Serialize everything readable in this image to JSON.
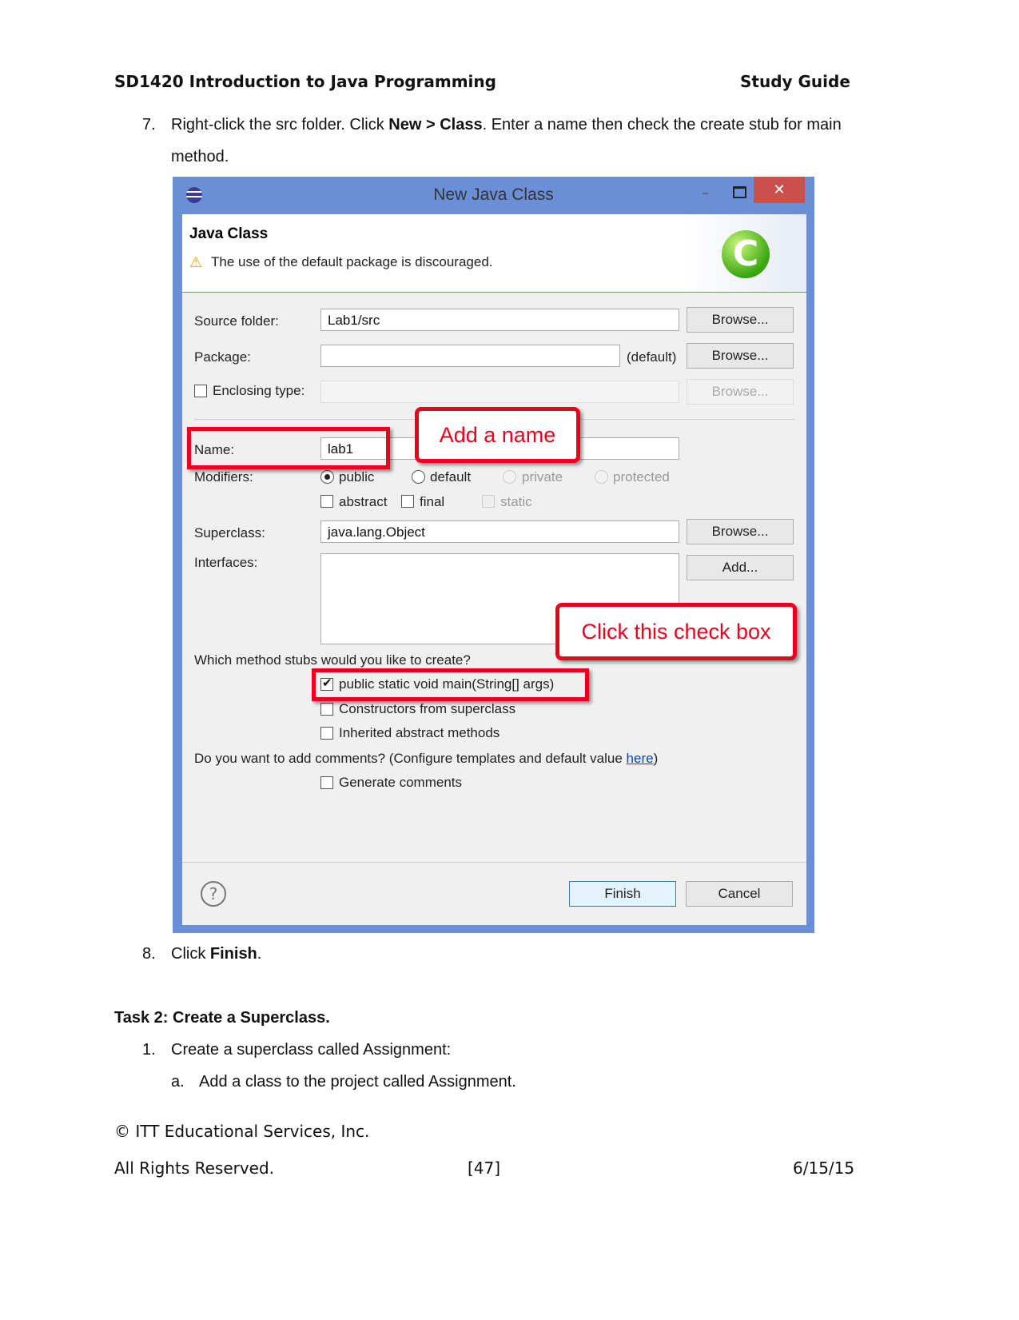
{
  "header": {
    "course": "SD1420 Introduction to Java Programming",
    "guide": "Study Guide"
  },
  "step7": {
    "num": "7.",
    "text_a": "Right-click the src folder. Click ",
    "bold_a": "New > Class",
    "text_b": ". Enter a name then check the create stub for main",
    "text_c": "method."
  },
  "dialog": {
    "title": "New Java Class",
    "section_title": "Java Class",
    "warning": "The use of the default package is discouraged.",
    "source_folder_label": "Source folder:",
    "source_folder_value": "Lab1/src",
    "package_label": "Package:",
    "package_value": "",
    "package_default": "(default)",
    "enclosing_label": "Enclosing type:",
    "browse": "Browse...",
    "name_label": "Name:",
    "name_value": "lab1",
    "modifiers_label": "Modifiers:",
    "modifiers": [
      "public",
      "default",
      "private",
      "protected"
    ],
    "abstract": "abstract",
    "final": "final",
    "static": "static",
    "superclass_label": "Superclass:",
    "superclass_value": "java.lang.Object",
    "interfaces_label": "Interfaces:",
    "add": "Add...",
    "stubs_question": "Which method stubs would you like to create?",
    "stub_main": "public static void main(String[] args)",
    "stub_constructors": "Constructors from superclass",
    "stub_inherited": "Inherited abstract methods",
    "comments_question": "Do you want to add comments? (Configure templates and default value ",
    "comments_link": "here",
    "comments_close": ")",
    "generate_comments": "Generate comments",
    "finish": "Finish",
    "cancel": "Cancel",
    "callout_name": "Add a name",
    "callout_check": "Click this check box",
    "colors": {
      "titlebar": "#6b8fd6",
      "close": "#c9504b",
      "callout": "#e8001c",
      "link": "#0645ad"
    }
  },
  "step8": {
    "num": "8.",
    "text": "Click ",
    "bold": "Finish",
    "end": "."
  },
  "task2": {
    "title": "Task 2: Create a Superclass.",
    "item1_num": "1.",
    "item1": "Create a superclass called Assignment:",
    "itema_num": "a.",
    "itema": "Add a class to the project called Assignment."
  },
  "footer": {
    "copyright": "© ITT Educational Services, Inc.",
    "rights": "All Rights Reserved.",
    "page": "[47]",
    "date": "6/15/15"
  }
}
